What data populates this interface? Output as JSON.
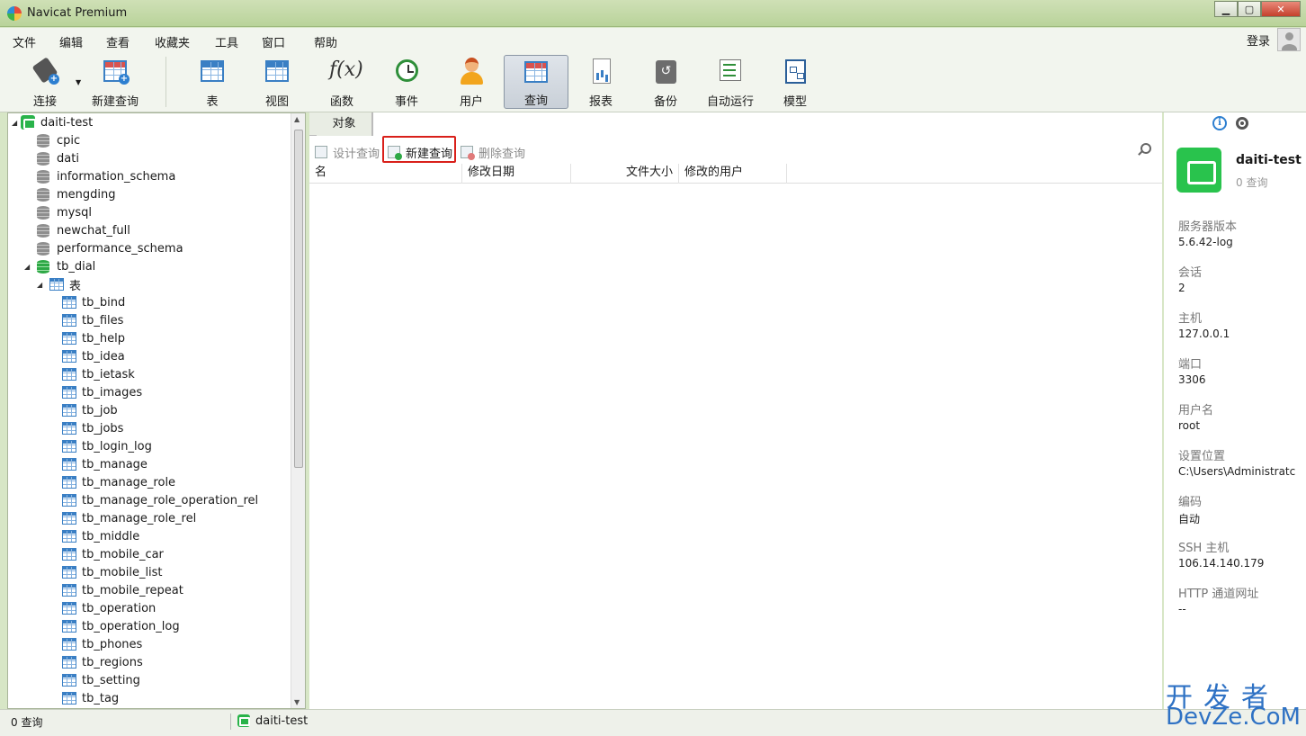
{
  "window": {
    "title": "Navicat Premium"
  },
  "menu": [
    "文件",
    "编辑",
    "查看",
    "收藏夹",
    "工具",
    "窗口",
    "帮助"
  ],
  "login_label": "登录",
  "toolbar": {
    "connect": "连接",
    "new_query": "新建查询",
    "table": "表",
    "view": "视图",
    "function": "函数",
    "event": "事件",
    "user": "用户",
    "query": "查询",
    "report": "报表",
    "backup": "备份",
    "auto_run": "自动运行",
    "model": "模型"
  },
  "tree": {
    "connection": "daiti-test",
    "databases": [
      "cpic",
      "dati",
      "information_schema",
      "mengding",
      "mysql",
      "newchat_full",
      "performance_schema",
      "tb_dial"
    ],
    "tables_folder": "表",
    "tables": [
      "tb_bind",
      "tb_files",
      "tb_help",
      "tb_idea",
      "tb_ietask",
      "tb_images",
      "tb_job",
      "tb_jobs",
      "tb_login_log",
      "tb_manage",
      "tb_manage_role",
      "tb_manage_role_operation_rel",
      "tb_manage_role_rel",
      "tb_middle",
      "tb_mobile_car",
      "tb_mobile_list",
      "tb_mobile_repeat",
      "tb_operation",
      "tb_operation_log",
      "tb_phones",
      "tb_regions",
      "tb_setting",
      "tb_tag"
    ]
  },
  "main": {
    "tab": "对象",
    "design_query": "设计查询",
    "new_query": "新建查询",
    "delete_query": "删除查询",
    "columns": [
      "名",
      "修改日期",
      "文件大小",
      "修改的用户"
    ]
  },
  "info": {
    "name": "daiti-test",
    "queries": "0 查询",
    "server_version_label": "服务器版本",
    "server_version": "5.6.42-log",
    "session_label": "会话",
    "session": "2",
    "host_label": "主机",
    "host": "127.0.0.1",
    "port_label": "端口",
    "port": "3306",
    "user_label": "用户名",
    "user": "root",
    "location_label": "设置位置",
    "location": "C:\\Users\\Administratc",
    "encoding_label": "编码",
    "encoding": "自动",
    "ssh_label": "SSH 主机",
    "ssh": "106.14.140.179",
    "http_label": "HTTP 通道网址",
    "http": "--"
  },
  "status": {
    "left": "0 查询",
    "connection": "daiti-test"
  },
  "watermark": {
    "top": "开发者",
    "bottom": "DevZe.CoM"
  }
}
